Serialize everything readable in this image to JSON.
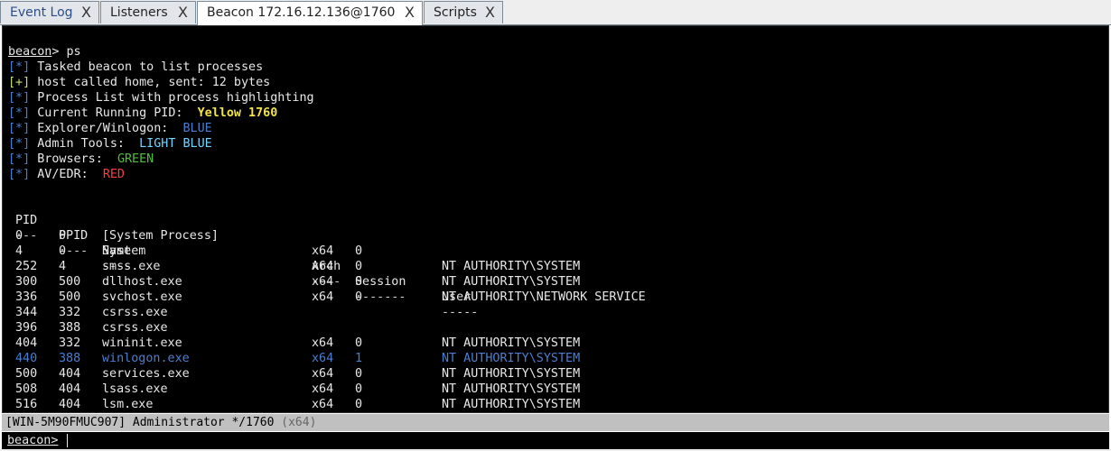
{
  "tabs": [
    {
      "label": "Event Log",
      "close": "X"
    },
    {
      "label": "Listeners",
      "close": "X"
    },
    {
      "label": "Beacon 172.16.12.136@1760",
      "close": "X"
    },
    {
      "label": "Scripts",
      "close": "X"
    }
  ],
  "terminal": {
    "partial_top": "  - - - - - - - - - -",
    "prompt": "beacon",
    "command": "> ps",
    "messages": [
      {
        "tag": "[*]",
        "text": "Tasked beacon to list processes",
        "value": ""
      },
      {
        "tag": "[+]",
        "text": "host called home, sent: 12 bytes",
        "value": ""
      },
      {
        "tag": "[*]",
        "text": "Process List with process highlighting",
        "value": ""
      },
      {
        "tag": "[*]",
        "text": "Current Running PID:",
        "value": "Yellow 1760"
      },
      {
        "tag": "[*]",
        "text": "Explorer/Winlogon:",
        "value": "BLUE"
      },
      {
        "tag": "[*]",
        "text": "Admin Tools:",
        "value": "LIGHT BLUE"
      },
      {
        "tag": "[*]",
        "text": "Browsers:",
        "value": "GREEN"
      },
      {
        "tag": "[*]",
        "text": "AV/EDR:",
        "value": "RED"
      }
    ],
    "table": {
      "headers": {
        "pid": "PID",
        "ppid": "PPID",
        "name": "Name",
        "arch": "Arch",
        "session": "Session",
        "user": "User"
      },
      "dashes": {
        "pid": "---",
        "ppid": "----",
        "name": "----",
        "arch": "----",
        "session": "-------",
        "user": "-----"
      },
      "rows": [
        {
          "pid": "0",
          "ppid": "0",
          "name": "[System Process]",
          "arch": "",
          "session": "",
          "user": "",
          "highlight": ""
        },
        {
          "pid": "4",
          "ppid": "0",
          "name": "System",
          "arch": "x64",
          "session": "0",
          "user": "",
          "highlight": ""
        },
        {
          "pid": "252",
          "ppid": "4",
          "name": "smss.exe",
          "arch": "x64",
          "session": "0",
          "user": "NT AUTHORITY\\SYSTEM",
          "highlight": ""
        },
        {
          "pid": "300",
          "ppid": "500",
          "name": "dllhost.exe",
          "arch": "x64",
          "session": "0",
          "user": "NT AUTHORITY\\SYSTEM",
          "highlight": ""
        },
        {
          "pid": "336",
          "ppid": "500",
          "name": "svchost.exe",
          "arch": "x64",
          "session": "0",
          "user": "NT AUTHORITY\\NETWORK SERVICE",
          "highlight": ""
        },
        {
          "pid": "344",
          "ppid": "332",
          "name": "csrss.exe",
          "arch": "",
          "session": "",
          "user": "",
          "highlight": ""
        },
        {
          "pid": "396",
          "ppid": "388",
          "name": "csrss.exe",
          "arch": "",
          "session": "",
          "user": "",
          "highlight": ""
        },
        {
          "pid": "404",
          "ppid": "332",
          "name": "wininit.exe",
          "arch": "x64",
          "session": "0",
          "user": "NT AUTHORITY\\SYSTEM",
          "highlight": ""
        },
        {
          "pid": "440",
          "ppid": "388",
          "name": "winlogon.exe",
          "arch": "x64",
          "session": "1",
          "user": "NT AUTHORITY\\SYSTEM",
          "highlight": "blue"
        },
        {
          "pid": "500",
          "ppid": "404",
          "name": "services.exe",
          "arch": "x64",
          "session": "0",
          "user": "NT AUTHORITY\\SYSTEM",
          "highlight": ""
        },
        {
          "pid": "508",
          "ppid": "404",
          "name": "lsass.exe",
          "arch": "x64",
          "session": "0",
          "user": "NT AUTHORITY\\SYSTEM",
          "highlight": ""
        },
        {
          "pid": "516",
          "ppid": "404",
          "name": "lsm.exe",
          "arch": "x64",
          "session": "0",
          "user": "NT AUTHORITY\\SYSTEM",
          "highlight": ""
        }
      ]
    }
  },
  "status": {
    "host": "[WIN-5M90FMUC907]",
    "user": "Administrator */1760",
    "arch": "(x64)"
  },
  "input": {
    "prompt": "beacon",
    "symbol": ">",
    "value": ""
  },
  "colors": {
    "terminal_bg": "#000000",
    "tag_info": "#4a7fd0",
    "tag_ok": "#bfe36a",
    "yellow": "#f2e34b",
    "blue": "#4a7fd0",
    "light_blue": "#74d3ff",
    "green": "#4fbf3a",
    "red": "#ff3d3d"
  }
}
